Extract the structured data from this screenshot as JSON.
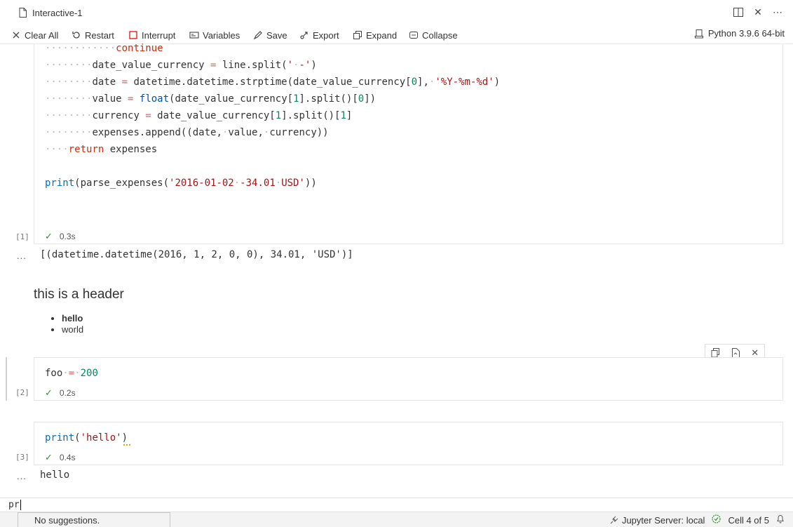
{
  "window": {
    "title": "Interactive-1"
  },
  "toolbar": {
    "clear_all": "Clear All",
    "restart": "Restart",
    "interrupt": "Interrupt",
    "variables": "Variables",
    "save": "Save",
    "export": "Export",
    "expand": "Expand",
    "collapse": "Collapse",
    "kernel": "Python 3.9.6 64-bit"
  },
  "cells": [
    {
      "exec_count": "[1]",
      "time": "0.3s",
      "output": "[(datetime.datetime(2016, 1, 2, 0, 0), 34.01, 'USD')]",
      "output_ellipsis": "..."
    },
    {
      "exec_count": "[2]",
      "time": "0.2s",
      "code": "foo = 200"
    },
    {
      "exec_count": "[3]",
      "time": "0.4s",
      "output": "hello",
      "output_ellipsis": "..."
    }
  ],
  "markdown": {
    "header": "this is a header",
    "items": [
      "hello",
      "world"
    ]
  },
  "input": {
    "value": "pr"
  },
  "suggest": {
    "text": "No suggestions."
  },
  "statusbar": {
    "jupyter": "Jupyter Server: local",
    "cell_position": "Cell 4 of 5"
  }
}
